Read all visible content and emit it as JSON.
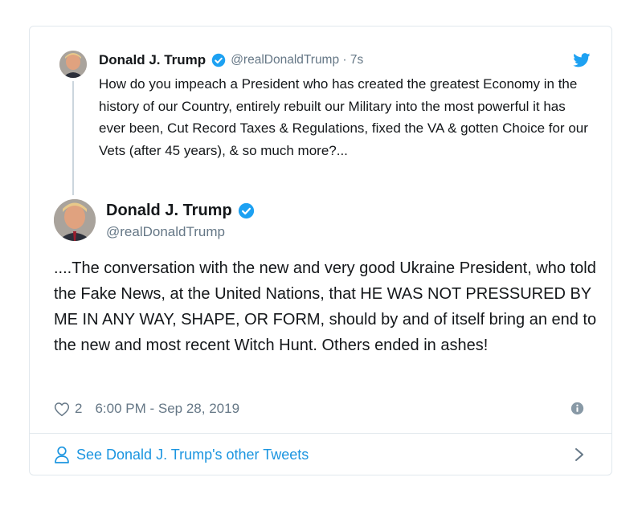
{
  "colors": {
    "text": "#14171a",
    "muted": "#657786",
    "link": "#1b95e0",
    "verified": "#1da1f2",
    "border": "#e1e8ed"
  },
  "parent_tweet": {
    "author_name": "Donald J. Trump",
    "handle_time": "@realDonaldTrump · 7s",
    "text": "How do you impeach a President who has created the greatest Economy in the history of our Country, entirely rebuilt our Military into the most powerful it has ever been, Cut Record Taxes & Regulations, fixed the VA & gotten Choice for our Vets (after 45 years), & so much more?...",
    "verified_icon": "verified-badge-icon",
    "brand_icon": "twitter-bird-icon"
  },
  "main_tweet": {
    "author_name": "Donald J. Trump",
    "handle": "@realDonaldTrump",
    "text": "....The conversation with the new and very good Ukraine President, who told the Fake News, at the United Nations, that HE WAS NOT PRESSURED BY ME IN ANY WAY, SHAPE, OR FORM, should by and of itself bring an end to the new and most recent Witch Hunt. Others ended in ashes!",
    "like_count": "2",
    "timestamp": "6:00 PM - Sep 28, 2019",
    "info_icon": "info-icon"
  },
  "footer": {
    "label": "See Donald J. Trump's other Tweets",
    "icon": "person-icon",
    "chevron": "chevron-right-icon"
  }
}
